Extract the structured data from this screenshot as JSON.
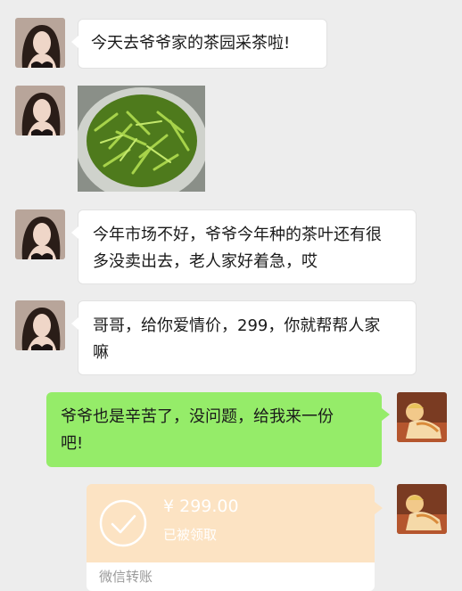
{
  "messages": [
    {
      "side": "left",
      "text": "今天去爷爷家的茶园采茶啦!"
    },
    {
      "side": "left",
      "type": "image",
      "image_desc": "tea-leaves-basket"
    },
    {
      "side": "left",
      "line1": "今年市场不好，爷爷今年种的茶叶还有很",
      "line2": "多没卖出去，老人家好着急，哎"
    },
    {
      "side": "left",
      "line1": "哥哥，给你爱情价，299，你就帮帮人家",
      "line2": "嘛"
    },
    {
      "side": "right",
      "line1": "爷爷也是辛苦了，没问题，给我来一份",
      "line2": "吧!"
    }
  ],
  "transfer": {
    "amount": "¥ 299.00",
    "status": "已被领取",
    "footer": "微信转账"
  },
  "colors": {
    "background": "#ededed",
    "bubble_self": "#95ec69",
    "bubble_other": "#ffffff",
    "transfer": "#fce3c3"
  }
}
